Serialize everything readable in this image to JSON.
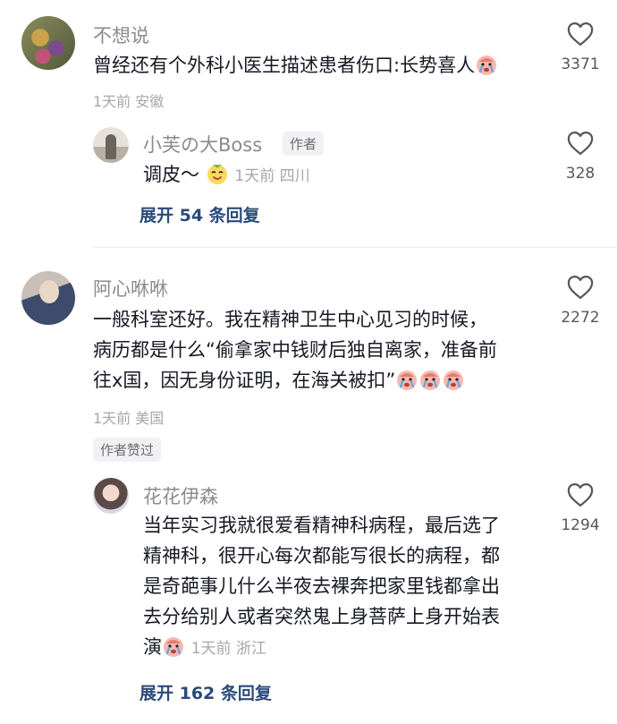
{
  "comments": [
    {
      "user": "不想说",
      "text_lines": [
        "曾经还有个外科小医生描述患者伤口:长势喜人"
      ],
      "meta": "1天前 安徽",
      "likes": "3371",
      "replies": [
        {
          "user": "小芙の大Boss",
          "badge": "作者",
          "text": "调皮～",
          "meta": "1天前 四川",
          "likes": "328"
        }
      ],
      "expand": "展开 54 条回复"
    },
    {
      "user": "阿心咻咻",
      "text_lines": [
        "一般科室还好。我在精神卫生中心见习的时候，",
        "病历都是什么“偷拿家中钱财后独自离家，准备前",
        "往x国，因无身份证明，在海关被扣”"
      ],
      "meta": "1天前 美国",
      "likes": "2272",
      "author_liked": "作者赞过",
      "replies": [
        {
          "user": "花花伊森",
          "text_lines": [
            "当年实习我就很爱看精神科病程，最后选了",
            "精神科，很开心每次都能写很长的病程，都",
            "是奇葩事儿什么半夜去裸奔把家里钱都拿出",
            "去分给别人或者突然鬼上身菩萨上身开始表",
            "演"
          ],
          "meta": "1天前 浙江",
          "likes": "1294"
        }
      ],
      "expand": "展开 162 条回复"
    }
  ],
  "icons": {
    "like": "heart-outline-icon",
    "emoji_cry": "crying-face-emoji",
    "emoji_sly": "sly-face-emoji"
  },
  "colors": {
    "name": "#8a8b91",
    "text": "#161823",
    "meta": "#a6a7ab",
    "expand": "#2a4a7a"
  }
}
